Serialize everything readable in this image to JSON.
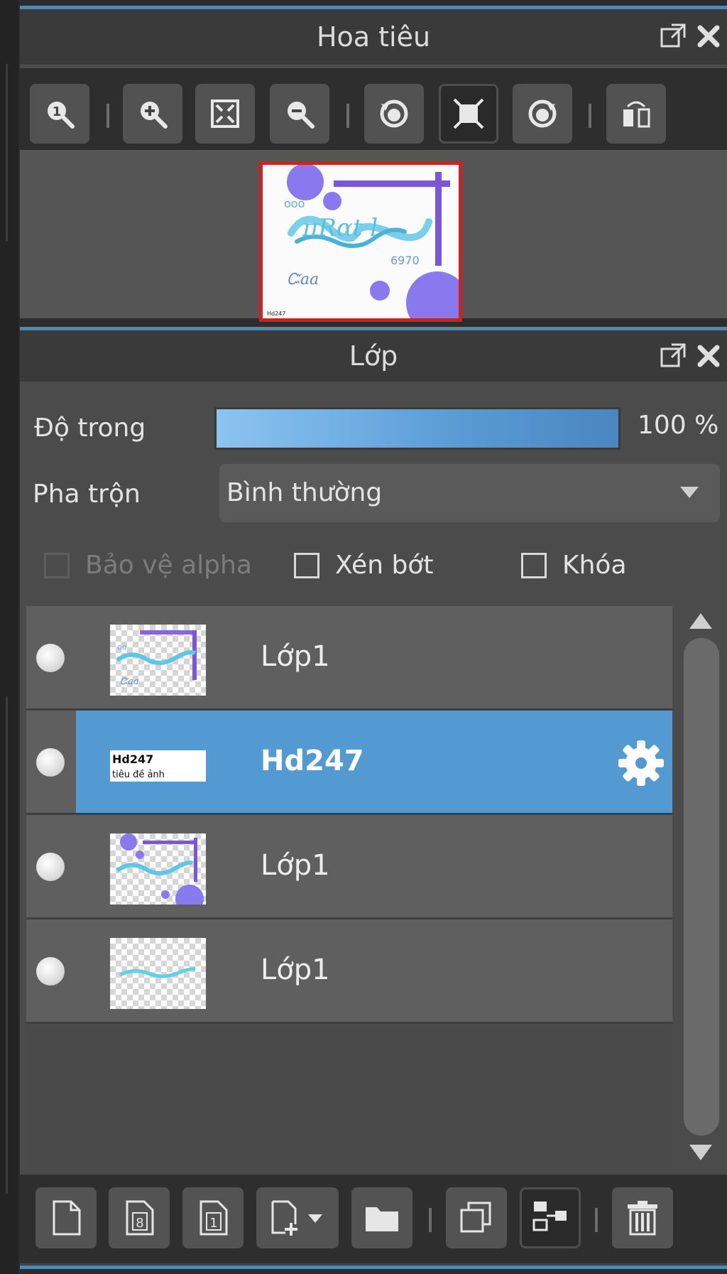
{
  "navigator": {
    "title": "Hoa tiêu",
    "buttons": [
      {
        "icon": "zoom-actual-size-icon"
      },
      {
        "icon": "zoom-in-icon"
      },
      {
        "icon": "fit-to-window-icon"
      },
      {
        "icon": "zoom-out-icon"
      },
      {
        "icon": "rotate-left-icon"
      },
      {
        "icon": "fullscreen-icon"
      },
      {
        "icon": "rotate-right-icon"
      },
      {
        "icon": "flip-horizontal-icon"
      }
    ]
  },
  "layers": {
    "title": "Lớp",
    "opacity_label": "Độ trong",
    "opacity_value": "100 %",
    "opacity_fraction": 1.0,
    "blend_label": "Pha trộn",
    "blend_value": "Bình thường",
    "checkboxes": [
      {
        "label": "Bảo vệ alpha",
        "enabled": false,
        "checked": false
      },
      {
        "label": "Xén bớt",
        "enabled": true,
        "checked": false
      },
      {
        "label": "Khóa",
        "enabled": true,
        "checked": false
      }
    ],
    "items": [
      {
        "name": "Lớp1",
        "selected": false
      },
      {
        "name": "Hd247",
        "selected": true
      },
      {
        "name": "Lớp1",
        "selected": false
      },
      {
        "name": "Lớp1",
        "selected": false
      }
    ],
    "thumb_text": [
      "Hd247",
      "tiêu đề ảnh"
    ]
  },
  "footer": {
    "buttons": [
      {
        "icon": "new-layer-icon"
      },
      {
        "icon": "new-8bit-layer-icon"
      },
      {
        "icon": "new-1bit-layer-icon"
      },
      {
        "icon": "add-layer-menu-icon"
      },
      {
        "icon": "new-folder-icon"
      },
      {
        "icon": "duplicate-layer-icon"
      },
      {
        "icon": "merge-down-icon"
      },
      {
        "icon": "delete-layer-icon"
      }
    ]
  },
  "colors": {
    "accent": "#539ad3",
    "panel_bg": "#4b4b4b",
    "preview_border": "#cc2222"
  }
}
